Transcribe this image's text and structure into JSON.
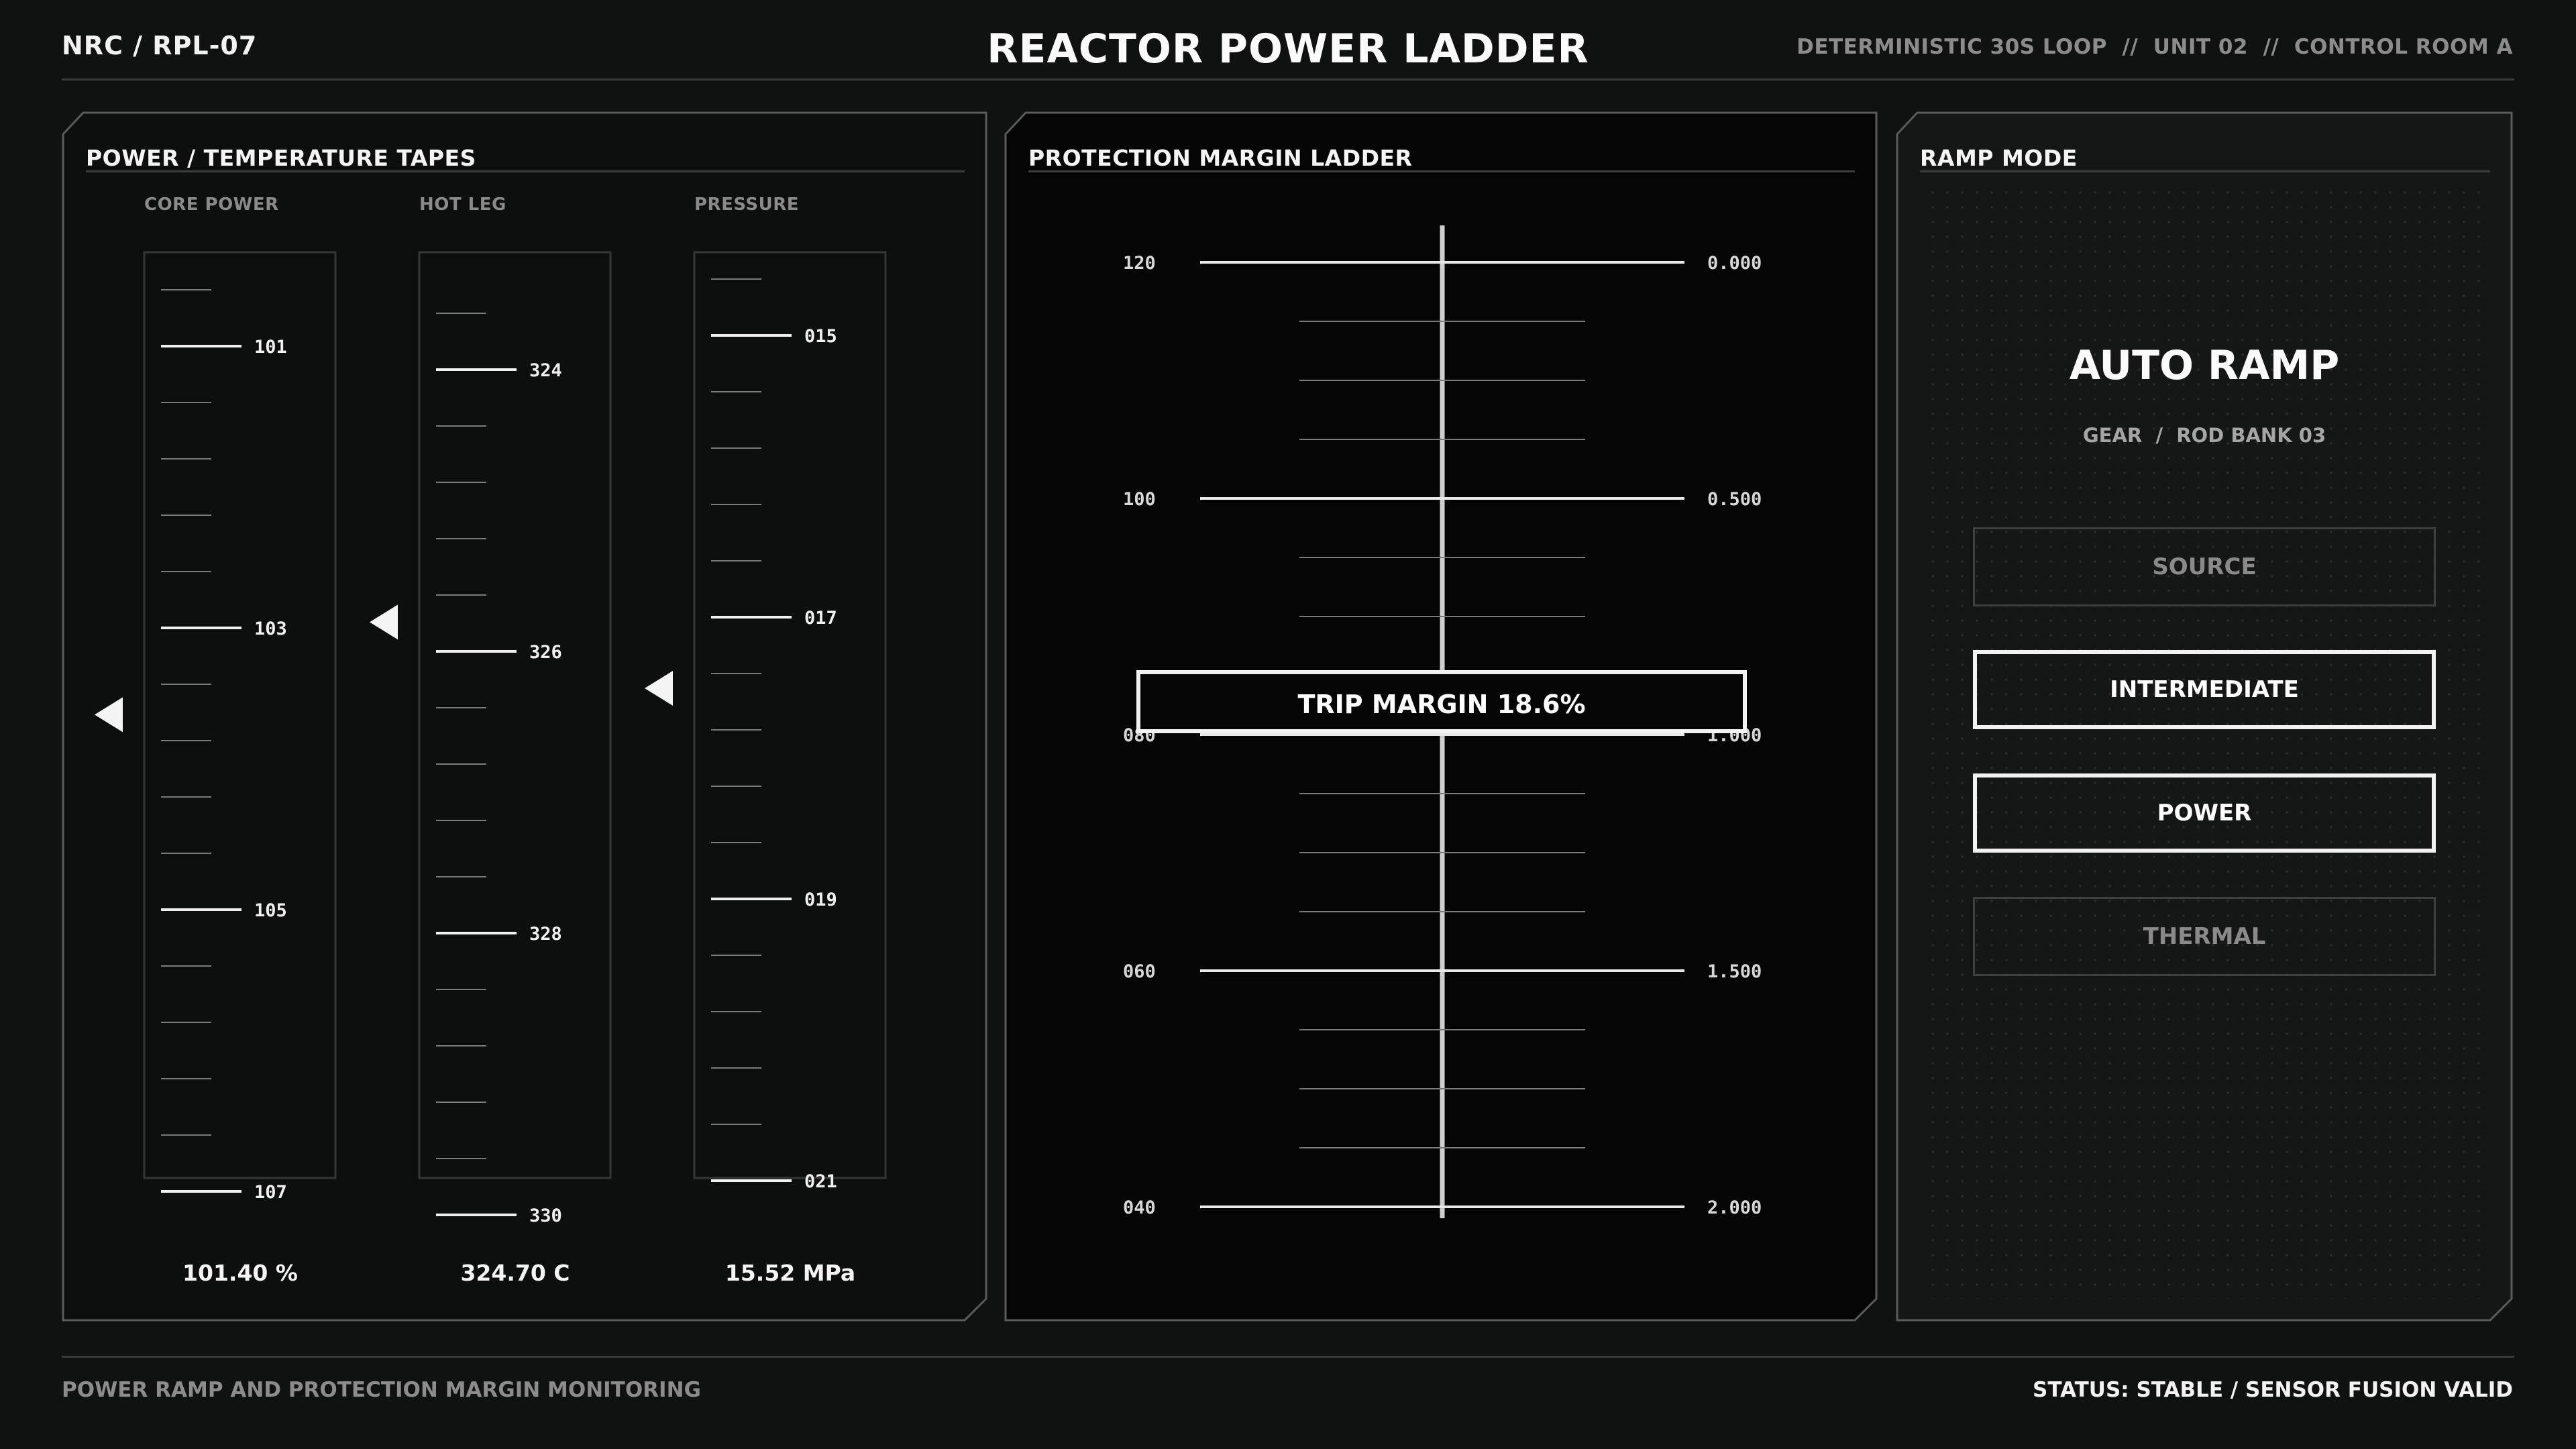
{
  "header": {
    "system_id": "NRC / RPL-07",
    "title": "REACTOR POWER LADDER",
    "meta": "DETERMINISTIC 30S LOOP  //  UNIT 02  //  CONTROL ROOM A"
  },
  "footer": {
    "description": "POWER RAMP AND PROTECTION MARGIN MONITORING",
    "status": "STATUS: STABLE / SENSOR FUSION VALID"
  },
  "tapes_panel": {
    "title": "POWER / TEMPERATURE TAPES",
    "tapes": [
      {
        "label": "CORE POWER",
        "ticks": [
          "101",
          "103",
          "105",
          "107"
        ],
        "pointer_value": 103.7,
        "scale_min": 100.0,
        "scale_max": 107.0,
        "readout": "101.40 %"
      },
      {
        "label": "HOT LEG",
        "ticks": [
          "324",
          "326",
          "328",
          "330"
        ],
        "pointer_value": 326.0,
        "scale_min": 323.0,
        "scale_max": 330.0,
        "readout": "324.70 C"
      },
      {
        "label": "PRESSURE",
        "ticks": [
          "015",
          "017",
          "019",
          "021"
        ],
        "pointer_value": 17.5,
        "scale_min": 14.0,
        "scale_max": 21.0,
        "readout": "15.52 MPa"
      }
    ]
  },
  "ladder_panel": {
    "title": "PROTECTION MARGIN LADDER",
    "left_scale": [
      "120",
      "100",
      "080",
      "060",
      "040"
    ],
    "right_scale": [
      "0.000",
      "0.500",
      "1.000",
      "1.500",
      "2.000"
    ],
    "trip_margin": "TRIP MARGIN 18.6%"
  },
  "ramp_panel": {
    "title": "RAMP MODE",
    "mode": "AUTO RAMP",
    "gear": "GEAR  /  ROD BANK 03",
    "modes": [
      {
        "label": "SOURCE",
        "active": false
      },
      {
        "label": "INTERMEDIATE",
        "active": true
      },
      {
        "label": "POWER",
        "active": true
      },
      {
        "label": "THERMAL",
        "active": false
      }
    ]
  }
}
